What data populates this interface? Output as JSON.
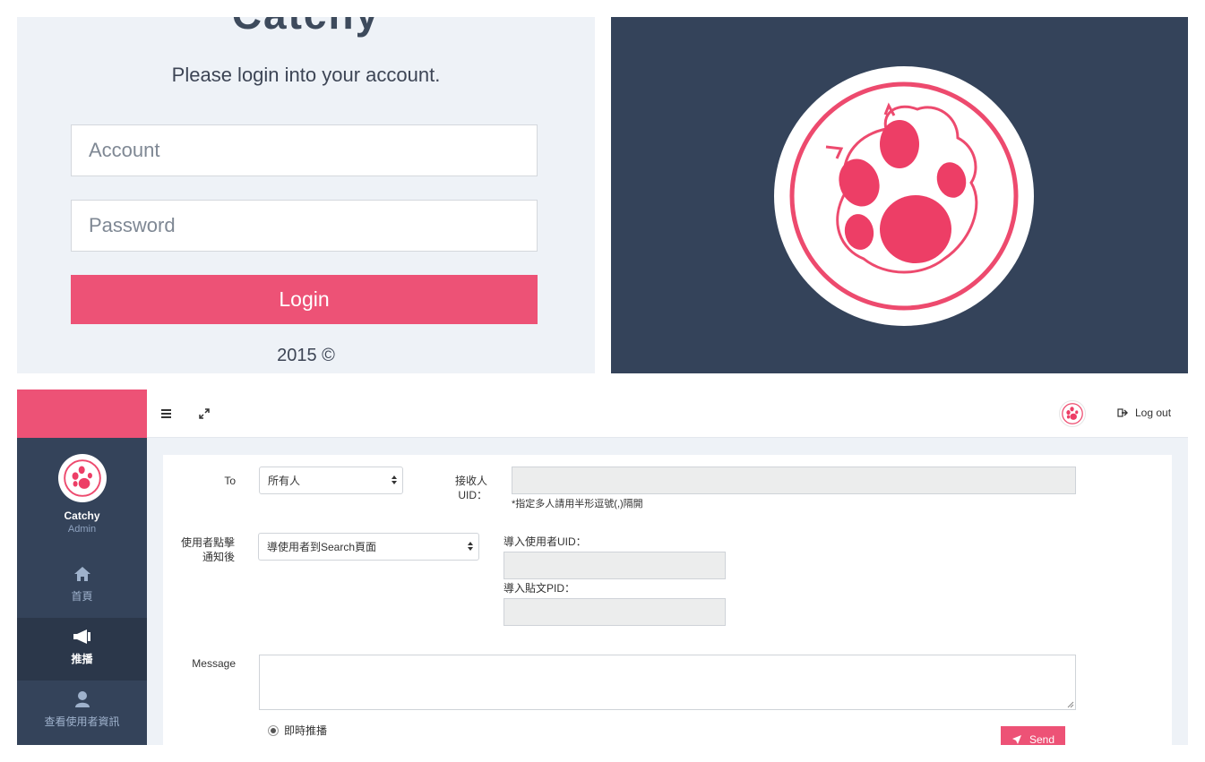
{
  "login": {
    "brand": "Catchy",
    "subtitle": "Please login into your account.",
    "account_placeholder": "Account",
    "password_placeholder": "Password",
    "login_button": "Login",
    "footer": "2015 ©"
  },
  "colors": {
    "accent": "#ed5276",
    "sidebar": "#34435a",
    "sidebar_active": "#2b374a",
    "login_bg": "#eef2f7"
  },
  "sidebar": {
    "profile_name": "Catchy",
    "profile_role": "Admin",
    "items": [
      {
        "label": "首頁",
        "icon": "home-icon"
      },
      {
        "label": "推播",
        "icon": "megaphone-icon",
        "active": true
      },
      {
        "label": "查看使用者資訊",
        "icon": "user-icon"
      }
    ]
  },
  "topbar": {
    "logout_label": "Log out"
  },
  "form": {
    "to_label": "To",
    "to_value": "所有人",
    "recipient_label_line1": "接收人",
    "recipient_label_line2": "UID：",
    "recipient_hint": "*指定多人請用半形逗號(,)隔開",
    "action_label_line1": "使用者點擊",
    "action_label_line2": "通知後",
    "action_value": "導使用者到Search頁面",
    "import_uid_label": "導入使用者UID：",
    "import_pid_label": "導入貼文PID：",
    "message_label": "Message",
    "radio_instant": "即時推播",
    "send_label": "Send"
  }
}
